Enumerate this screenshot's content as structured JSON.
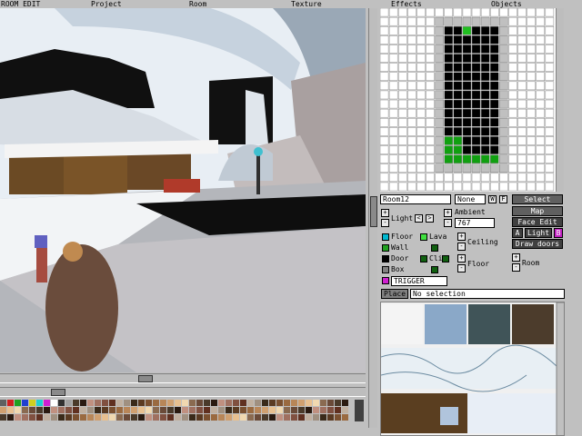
{
  "menu": [
    "ROOM EDIT",
    "Project",
    "Room",
    "Texture",
    "Effects",
    "Objects"
  ],
  "room": {
    "name": "Room12",
    "group": "None",
    "btn_w": "W",
    "btn_f": "F"
  },
  "light": {
    "label": "Light",
    "plus": "+",
    "minus": "-",
    "left": "<",
    "right": ">"
  },
  "ambient": {
    "label": "Ambient",
    "value": "767"
  },
  "ceiling_label": "Ceiling",
  "floor_label": "Floor",
  "room_label": "Room",
  "sector_types": [
    {
      "label": "Floor",
      "color": "#00b8d0"
    },
    {
      "label": "Lava",
      "color": "#40e040"
    },
    {
      "label": "Wall",
      "color": "#20a020"
    },
    {
      "label": "Door",
      "color": "#000000"
    },
    {
      "label": "Box",
      "color": "#808080"
    }
  ],
  "cli_label": "Cli",
  "trigger": {
    "label": "TRIGGER",
    "color": "#d020d0"
  },
  "buttons": {
    "select": "Select",
    "map": "Map",
    "face_edit": "Face Edit",
    "a": "A",
    "light": "Light",
    "b": "B",
    "draw_doors": "Draw doors"
  },
  "place": {
    "button": "Place",
    "status": "No selection"
  },
  "colors": {
    "scene_bg": "#dfe7ef",
    "grid_room": "#000000",
    "grid_wall": "#c0c0c0",
    "grid_floor": "#10a010",
    "grid_selected": "#20c020"
  },
  "texture_swatches": [
    "#f4f4f4",
    "#8aa8c8",
    "#405458",
    "#4c3c2c"
  ]
}
